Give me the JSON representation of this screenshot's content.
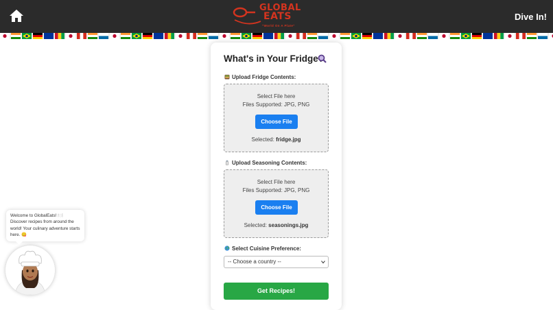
{
  "header": {
    "logo_line1": "GLOBAL",
    "logo_line2": "EATS",
    "logo_tagline": "\"World On A Plate\"",
    "dive_in_label": "Dive In!"
  },
  "colors": {
    "header_bg": "#2b2b2b",
    "logo_red": "#d4341f",
    "choose_button": "#1a7ff0",
    "submit_button": "#28a745"
  },
  "card": {
    "title": "What's in Your Fridge?",
    "fridge": {
      "label": "Upload Fridge Contents:",
      "line1": "Select File here",
      "line2": "Files Supported: JPG, PNG",
      "button": "Choose File",
      "selected_prefix": "Selected: ",
      "selected_file": "fridge.jpg"
    },
    "seasoning": {
      "label": "Upload Seasoning Contents:",
      "line1": "Select File here",
      "line2": "Files Supported: JPG, PNG",
      "button": "Choose File",
      "selected_prefix": "Selected: ",
      "selected_file": "seasonings.jpg"
    },
    "cuisine": {
      "label": "Select Cuisine Preference:",
      "selected_option": "-- Choose a country --"
    },
    "submit_label": "Get Recipes!"
  },
  "chat_bubble": {
    "message": "Welcome to GlobalEats! 🍽️ Discover recipes from around the world! Your culinary adventure starts here. 😋"
  },
  "icons": {
    "home": "home-icon",
    "magnify": "magnifying-glass-icon",
    "fridge": "food-icon",
    "seasoning": "salt-shaker-icon",
    "globe": "globe-icon"
  }
}
